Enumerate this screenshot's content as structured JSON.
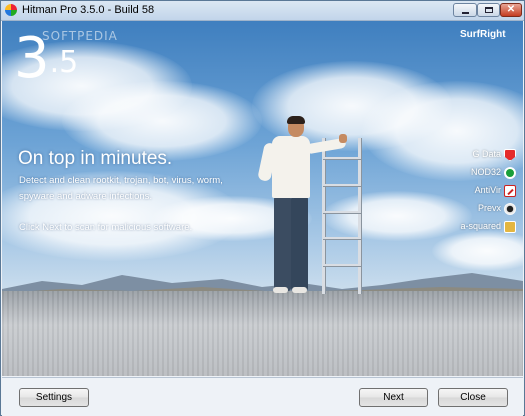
{
  "window": {
    "title": "Hitman Pro 3.5.0 - Build 58",
    "controls": {
      "minimize_icon": "minimize-icon",
      "maximize_icon": "maximize-icon",
      "close_icon": "close-x-icon",
      "close_glyph": "✕"
    }
  },
  "hero": {
    "version_main": "3",
    "version_minor": ".5",
    "watermark": "SOFTPEDIA",
    "brand": "SurfRight",
    "headline": "On top in minutes.",
    "description_lines": [
      "Detect and clean rootkit, trojan, bot, virus, worm,",
      "spyware and adware infections."
    ],
    "cta": "Click Next to scan for malicious software."
  },
  "engines": [
    {
      "name": "G Data",
      "icon": "gdata-shield-icon",
      "color": "#e52b2b"
    },
    {
      "name": "NOD32",
      "icon": "nod32-eye-icon",
      "color": "#1a9e3a"
    },
    {
      "name": "AntiVir",
      "icon": "antivir-umbrella-icon",
      "color": "#cc2222"
    },
    {
      "name": "Prevx",
      "icon": "prevx-eye-icon",
      "color": "#222222"
    },
    {
      "name": "a-squared",
      "icon": "asquared-icon",
      "color": "#e4b640"
    }
  ],
  "footer": {
    "settings_label": "Settings",
    "next_label": "Next",
    "close_label": "Close"
  }
}
